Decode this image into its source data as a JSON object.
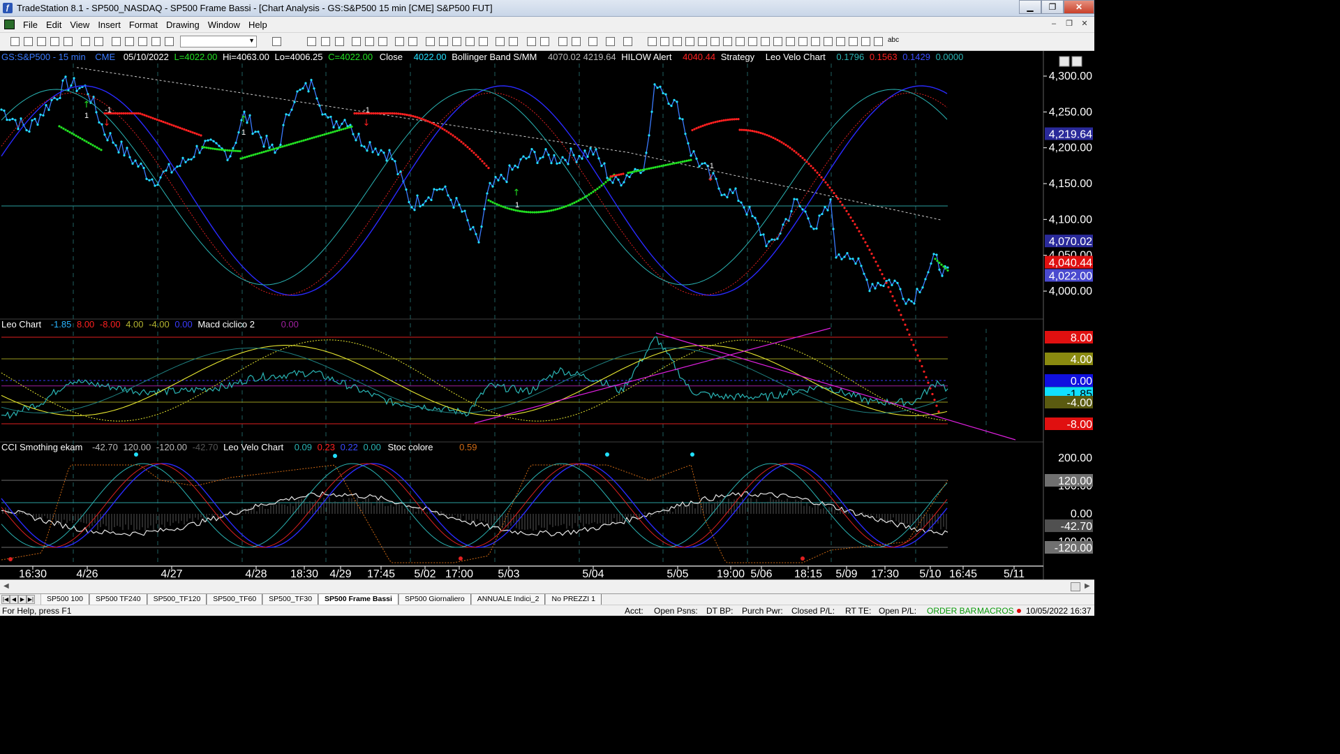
{
  "window": {
    "title": "TradeStation 8.1 - SP500_NASDAQ - SP500 Frame Bassi - [Chart Analysis - GS:S&P500  15 min  [CME] S&P500 FUT]",
    "minimize": "▁",
    "maximize": "❐",
    "close": "✕"
  },
  "menu": {
    "items": [
      "File",
      "Edit",
      "View",
      "Insert",
      "Format",
      "Drawing",
      "Window",
      "Help"
    ]
  },
  "toolbar": {
    "text_tool": "abc"
  },
  "header": {
    "symbol": "GS:S&P500 - 15 min",
    "exchange": "CME",
    "date": "05/10/2022",
    "last": "L=4022.00",
    "hi": "Hi=4063.00",
    "lo": "Lo=4006.25",
    "close": "C=4022.00",
    "close_label": "Close",
    "close_value": "4022.00",
    "bb_label": "Bollinger Band S/MM",
    "bb_values": "4070.02  4219.64",
    "hilow_label": "HILOW Alert",
    "hilow_value": "4040.44",
    "strategy_label": "Strategy",
    "leo_label": "Leo Velo Chart",
    "leo_v1": "0.1796",
    "leo_v2": "0.1563",
    "leo_v3": "0.1429",
    "leo_v4": "0.0000"
  },
  "subgraph2": {
    "label": "Leo Chart",
    "v1": "-1.85",
    "v2": "8.00",
    "v3": "-8.00",
    "v4": "4.00",
    "v5": "-4.00",
    "v6": "0.00",
    "macd_label": "Macd ciclico 2",
    "macd_value": "0.00"
  },
  "subgraph3": {
    "label": "CCI Smothing ekam",
    "v1": "-42.70",
    "v2": "120.00",
    "v3": "-120.00",
    "v4": "-42.70",
    "leo_label": "Leo Velo Chart",
    "leo_v1": "0.09",
    "leo_v2": "0.23",
    "leo_v3": "0.22",
    "leo_v4": "0.00",
    "stoc_label": "Stoc colore",
    "stoc_value": "0.59"
  },
  "axis": {
    "price_ticks": [
      "4,300.00",
      "4,250.00",
      "4,200.00",
      "4,150.00",
      "4,100.00",
      "4,050.00",
      "4,000.00"
    ],
    "price_markers": {
      "bb_upper": "4,219.64",
      "bb_lower": "4,070.02",
      "hilow": "4,040.44",
      "last": "4,022.00"
    },
    "osc_markers": {
      "plus8": "8.00",
      "plus4": "4.00",
      "zero": "0.00",
      "current": "-1.85",
      "minus4": "-4.00",
      "minus8": "-8.00"
    },
    "cci_ticks": [
      "200.00",
      "100.00",
      "0.00",
      "-100.00"
    ],
    "cci_markers": {
      "plus120": "120.00",
      "current": "-42.70",
      "minus120": "-120.00"
    },
    "time_labels": [
      "16:30",
      "4/26",
      "4/27",
      "4/28",
      "18:30",
      "4/29",
      "17:45",
      "5/02",
      "17:00",
      "5/03",
      "5/04",
      "5/05",
      "19:00",
      "5/06",
      "18:15",
      "5/09",
      "17:30",
      "5/10",
      "16:45",
      "5/11"
    ]
  },
  "tabs": [
    "SP500 100",
    "SP500 TF240",
    "SP500_TF120",
    "SP500_TF60",
    "SP500_TF30",
    "SP500 Frame Bassi",
    "SP500 Giornaliero",
    "ANNUALE Indici_2",
    "No PREZZI 1"
  ],
  "active_tab": "SP500 Frame Bassi",
  "status": {
    "help": "For Help, press F1",
    "acct": "Acct:",
    "open_psns": "Open Psns:",
    "dt_bp": "DT BP:",
    "purch_pwr": "Purch Pwr:",
    "closed_pl": "Closed P/L:",
    "rt_te": "RT TE:",
    "open_pl": "Open P/L:",
    "order_bar": "ORDER BAR",
    "macros": "MACROS",
    "datetime": "10/05/2022 16:37"
  },
  "colors": {
    "price": "#3a7bff",
    "price_dots": "#22e0ff",
    "hilow_up": "#22e022",
    "hilow_down": "#ff2020",
    "bb_mid": "#cfcfcf",
    "osc_yellow": "#e8e830",
    "osc_cyan": "#2ab5b5",
    "trendline": "#e020e0",
    "cci_white": "#e8e8e8",
    "cci_orange": "#d06a14"
  }
}
